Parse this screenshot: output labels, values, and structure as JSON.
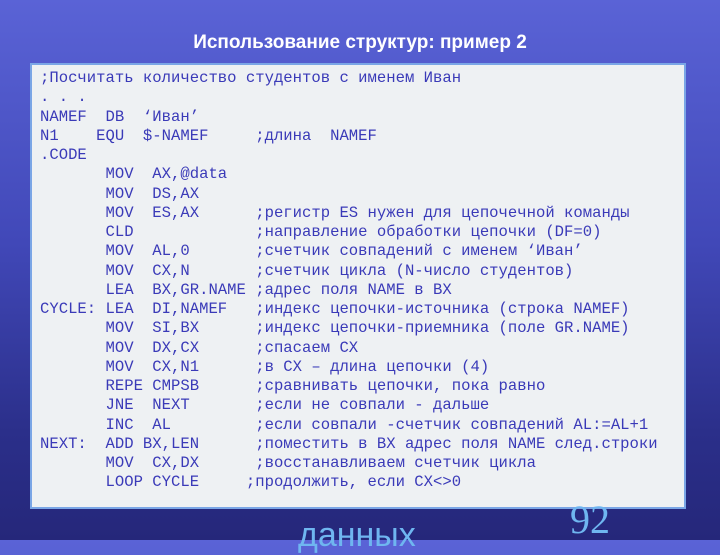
{
  "slide": {
    "title": "Использование структур: пример 2",
    "page_number": "92",
    "footer_word": "данных"
  },
  "code": {
    "lines": [
      ";Посчитать количество студентов с именем Иван",
      ". . .",
      "NAMEF  DB  ‘Иван’",
      "N1    EQU  $-NAMEF     ;длина  NAMEF",
      ".CODE",
      "       MOV  AX,@data",
      "       MOV  DS,AX",
      "       MOV  ES,AX      ;регистр ES нужен для цепочечной команды",
      "       CLD             ;направление обработки цепочки (DF=0)",
      "       MOV  AL,0       ;счетчик совпадений с именем ‘Иван’",
      "       MOV  CX,N       ;счетчик цикла (N-число студентов)",
      "       LEA  BX,GR.NAME ;адрес поля NAME в BX",
      "CYCLE: LEA  DI,NAMEF   ;индекс цепочки-источника (строка NAMEF)",
      "       MOV  SI,BX      ;индекс цепочки-приемника (поле GR.NAME)",
      "       MOV  DX,CX      ;спасаем CX",
      "       MOV  CX,N1      ;в CX – длина цепочки (4)",
      "       REPE CMPSB      ;сравнивать цепочки, пока равно",
      "       JNE  NEXT       ;если не совпали - дальше",
      "       INC  AL         ;если совпали -счетчик совпадений AL:=AL+1",
      "NEXT:  ADD BX,LEN      ;поместить в BX адрес поля NAME след.строки",
      "       MOV  CX,DX      ;восстанавливаем счетчик цикла",
      "       LOOP CYCLE     ;продолжить, если CX<>0"
    ]
  },
  "colors": {
    "background": "#4148b8",
    "code_text": "#3a3ab8",
    "code_background": "#eef1f3",
    "accent": "#6fb6f0"
  }
}
